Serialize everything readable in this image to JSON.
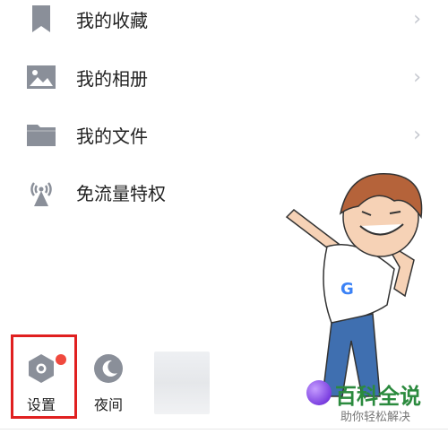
{
  "menu": {
    "items": [
      {
        "label": "我的收藏",
        "icon": "bookmark-icon",
        "has_chevron": true
      },
      {
        "label": "我的相册",
        "icon": "image-icon",
        "has_chevron": true
      },
      {
        "label": "我的文件",
        "icon": "folder-icon",
        "has_chevron": true
      },
      {
        "label": "免流量特权",
        "icon": "antenna-icon",
        "has_chevron": false
      }
    ],
    "chevron": "›"
  },
  "bottom": {
    "settings_label": "设置",
    "night_label": "夜间",
    "settings_icon": "hexagon-gear-icon",
    "night_icon": "moon-icon",
    "badge_color": "#f0493e"
  },
  "watermark": {
    "title": "百科全说",
    "subtitle": "助你轻松解决"
  },
  "colors": {
    "icon_gray": "#8a8f99",
    "highlight": "#e02020",
    "chevron": "#c5c8cf"
  }
}
